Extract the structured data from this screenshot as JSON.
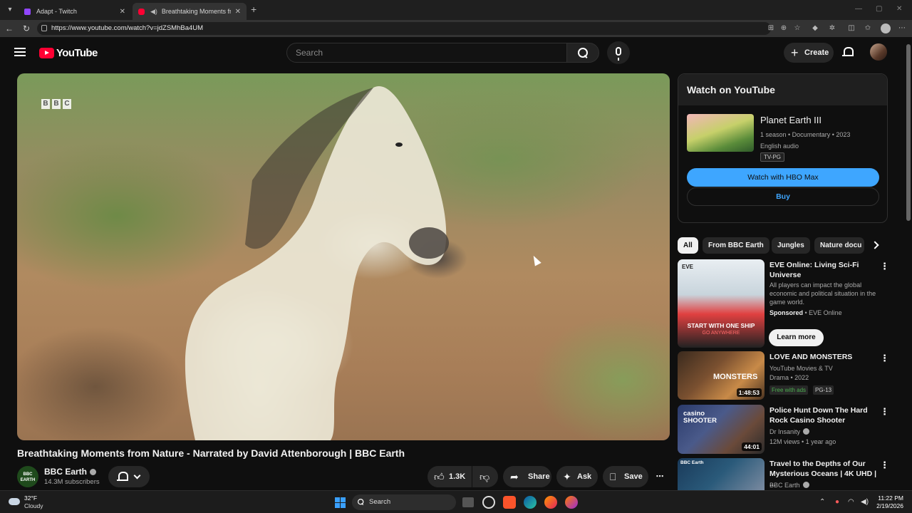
{
  "browser": {
    "tabs": [
      {
        "title": "Adapt - Twitch"
      },
      {
        "title": "Breathtaking Moments from N"
      }
    ],
    "url": "https://www.youtube.com/watch?v=jdZSMhBa4UM"
  },
  "header": {
    "logo_text": "YouTube",
    "search_placeholder": "Search",
    "create_label": "Create"
  },
  "player": {
    "watermark": [
      "B",
      "B",
      "C"
    ]
  },
  "video": {
    "title": "Breathtaking Moments from Nature - Narrated by David Attenborough | BBC Earth",
    "channel": "BBC Earth",
    "channel_avatar_text": "BBC EARTH",
    "subscribers": "14.3M subscribers",
    "likes": "1.3K",
    "share_label": "Share",
    "ask_label": "Ask",
    "save_label": "Save"
  },
  "watch_panel": {
    "heading": "Watch on YouTube",
    "title": "Planet Earth III",
    "meta": "1 season • Documentary • 2023",
    "audio": "English audio",
    "rating": "TV-PG",
    "primary_button": "Watch with HBO Max",
    "secondary_button": "Buy"
  },
  "chips": [
    "All",
    "From BBC Earth",
    "Jungles",
    "Nature docu"
  ],
  "recommendations": [
    {
      "title": "EVE Online: Living Sci-Fi Universe",
      "description": "All players can impact the global economic and political situation in the game world.",
      "sponsor_label": "Sponsored",
      "sponsor": " • EVE Online",
      "cta": "Learn more",
      "thumb_text": "START WITH ONE SHIP",
      "thumb_subtext": "GO ANYWHERE"
    },
    {
      "title": "LOVE AND MONSTERS",
      "channel": "YouTube Movies & TV",
      "meta": "Drama • 2022",
      "badge": "Free with ads",
      "rating": "PG-13",
      "duration": "1:48:53",
      "thumb_text": "MONSTERS"
    },
    {
      "title": "Police Hunt Down The Hard Rock Casino Shooter",
      "channel": "Dr Insanity",
      "meta": "12M views • 1 year ago",
      "duration": "44:01",
      "thumb_text": "casino SHOOTER"
    },
    {
      "title": "Travel to the Depths of Our Mysterious Oceans | 4K UHD | ...",
      "channel": "BBC Earth"
    }
  ],
  "taskbar": {
    "temperature": "32°F",
    "weather": "Cloudy",
    "search_label": "Search",
    "time": "11:22 PM",
    "date": "2/19/2026"
  },
  "colors": {
    "youtube_red": "#ff0033",
    "hbo_button": "#3ea6ff",
    "background": "#0f0f0f"
  }
}
